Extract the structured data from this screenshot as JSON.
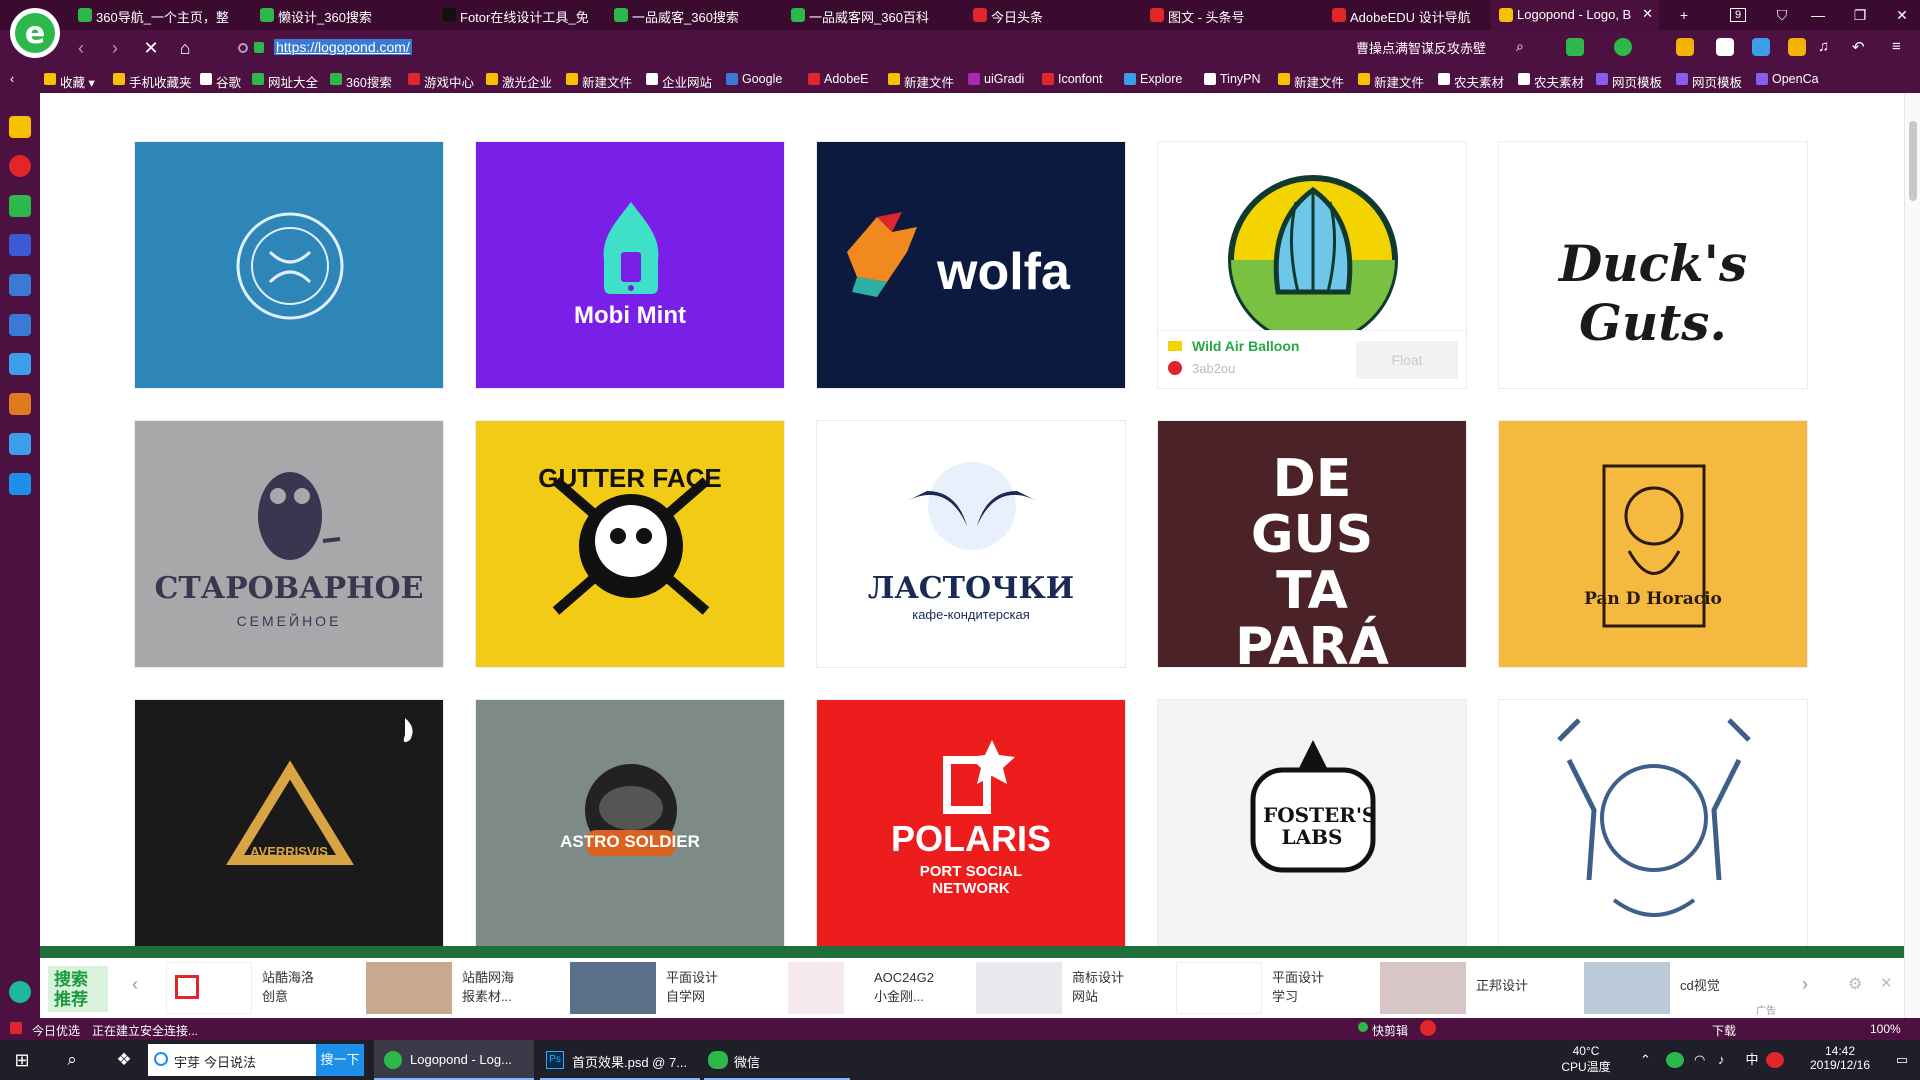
{
  "tabs": [
    {
      "label": "360导航_一个主页，整",
      "color": "#2cb84a"
    },
    {
      "label": "懒设计_360搜索",
      "color": "#2cb84a"
    },
    {
      "label": "Fotor在线设计工具_免",
      "color": "#1a1a1a"
    },
    {
      "label": "一品威客_360搜索",
      "color": "#2cb84a"
    },
    {
      "label": "一品威客网_360百科",
      "color": "#2cb84a"
    },
    {
      "label": "今日头条",
      "color": "#e0262a"
    },
    {
      "label": "图文 - 头条号",
      "color": "#e0262a"
    },
    {
      "label": "AdobeEDU 设计导航",
      "color": "#e0262a"
    },
    {
      "label": "Logopond - Logo, B",
      "color": "#f7c100"
    }
  ],
  "tab_count": "9",
  "url": "https://logopond.com/",
  "search_suggestion": "曹操点满智谋反攻赤壁",
  "bookmarks": [
    "收藏",
    "手机收藏夹",
    "谷歌",
    "网址大全",
    "360搜索",
    "游戏中心",
    "激光企业",
    "新建文件",
    "企业网站",
    "Google",
    "AdobeE",
    "新建文件",
    "uiGradi",
    "Iconfont",
    "Explore",
    "TinyPN",
    "新建文件",
    "新建文件",
    "农夫素材",
    "农夫素材",
    "网页模板",
    "网页模板",
    "OpenCa"
  ],
  "cards": [
    {
      "name": "",
      "bg": "#2e86b8"
    },
    {
      "name": "Mobi Mint",
      "bg": "#7a1fe8"
    },
    {
      "name": "wolfa",
      "bg": "#0d1a3f"
    },
    {
      "name": "Wild Air Balloon",
      "bg": "#ffffff",
      "author": "3ab2ou",
      "button": "Float"
    },
    {
      "name": "Duck's Guts.",
      "bg": "#ffffff"
    },
    {
      "name": "СТАРОВАРНОЕ",
      "sub": "СЕМЕЙНОЕ",
      "bg": "#a8a8ab"
    },
    {
      "name": "GUTTER FACE",
      "bg": "#f2cb16"
    },
    {
      "name": "ЛАСТОЧКИ",
      "sub": "кафе-кондитерская",
      "bg": "#ffffff"
    },
    {
      "name": "DE GUS TA PARÁ",
      "bg": "#4a2228"
    },
    {
      "name": "Pan D Horacio",
      "bg": "#f5b93f"
    },
    {
      "name": "AVERRISVIS",
      "bg": "#1a1a1a"
    },
    {
      "name": "ASTRO SOLDIER",
      "bg": "#7d8a85"
    },
    {
      "name": "POLARIS",
      "sub": "PORT SOCIAL NETWORK",
      "bg": "#ee1d1d"
    },
    {
      "name": "FOSTER'S LABS",
      "bg": "#f4f4f4"
    },
    {
      "name": "",
      "bg": "#ffffff"
    }
  ],
  "ad_label": "搜索推荐",
  "ads": [
    {
      "line1": "站酷海洛",
      "line2": "创意"
    },
    {
      "line1": "站酷网海",
      "line2": "报素材..."
    },
    {
      "line1": "平面设计",
      "line2": "自学网"
    },
    {
      "line1": "AOC24G2",
      "line2": "小金刚..."
    },
    {
      "line1": "商标设计",
      "line2": "网站"
    },
    {
      "line1": "平面设计",
      "line2": "学习"
    },
    {
      "line1": "正邦设计",
      "line2": ""
    },
    {
      "line1": "cd视觉",
      "line2": ""
    }
  ],
  "ad_tag": "广告",
  "status_left": "今日优选",
  "status_text": "正在建立安全连接...",
  "status_right": {
    "clip": "快剪辑",
    "download": "下载",
    "zoom": "100%"
  },
  "taskbar": {
    "search_user": "宇芽",
    "search_text": "今日说法",
    "search_btn": "搜一下",
    "apps": [
      "Logopond - Log...",
      "首页效果.psd @ 7...",
      "微信"
    ],
    "temp": "40°C",
    "temp_label": "CPU温度",
    "lang": "中",
    "time": "14:42",
    "date": "2019/12/16"
  }
}
